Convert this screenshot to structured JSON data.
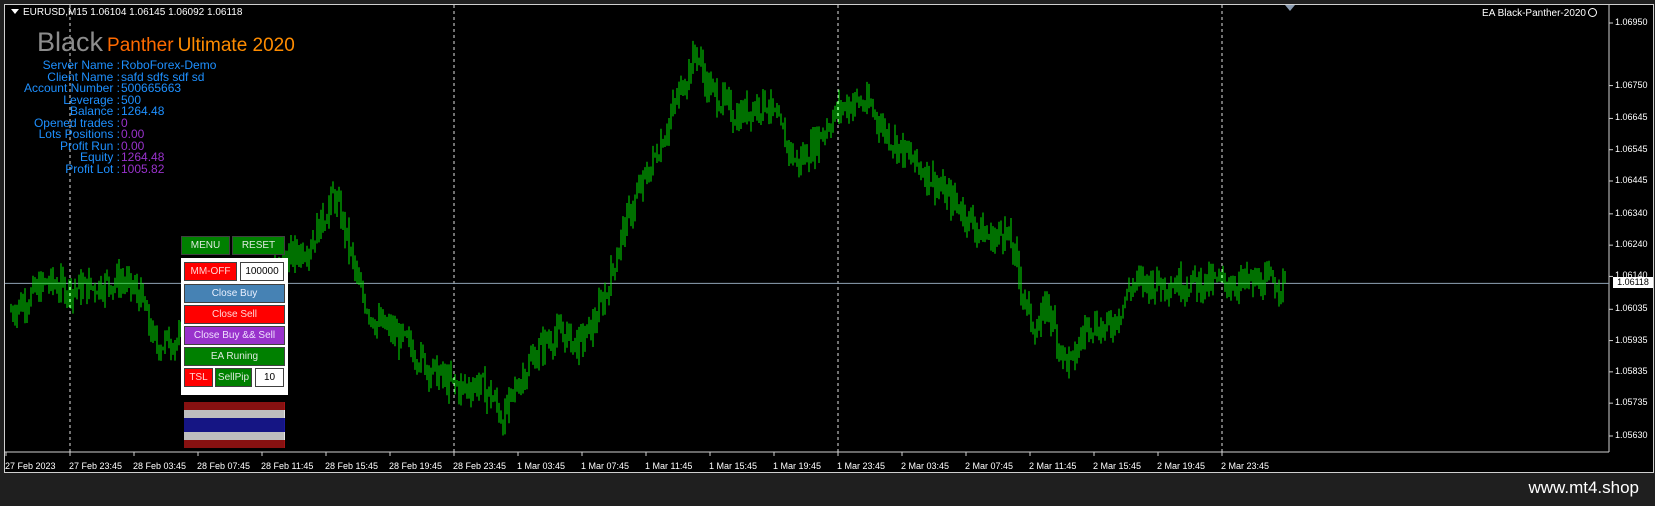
{
  "header": {
    "symbol_line": "EURUSD,M15  1.06104 1.06145 1.06092 1.06118",
    "ea_label": "EA Black-Panther-2020"
  },
  "logo": {
    "word1": "Black",
    "word2": "Panther",
    "word3": "Ultimate 2020"
  },
  "info": [
    {
      "label": "Server Name :",
      "value": "RoboForex-Demo",
      "value_color": "#1e90ff"
    },
    {
      "label": "Client Name :",
      "value": "safd     sdfs sdf  sd",
      "value_color": "#1e90ff"
    },
    {
      "label": "Account Number :",
      "value": "500665663",
      "value_color": "#1e90ff"
    },
    {
      "label": "Leverage :",
      "value": "500",
      "value_color": "#1e90ff"
    },
    {
      "label": "Balance :",
      "value": "1264.48",
      "value_color": "#1e90ff"
    },
    {
      "label": "Opened trades :",
      "value": "0",
      "value_color": "#9932cc"
    },
    {
      "label": "Lots Positions :",
      "value": "0.00",
      "value_color": "#9932cc"
    },
    {
      "label": "Profit Run :",
      "value": "0.00",
      "value_color": "#9932cc"
    },
    {
      "label": "Equity :",
      "value": "1264.48",
      "value_color": "#9932cc"
    },
    {
      "label": "Profit Lot :",
      "value": "1005.82",
      "value_color": "#9932cc"
    }
  ],
  "panel": {
    "menu": "MENU",
    "reset": "RESET",
    "mm_off": "MM-OFF",
    "mm_value": "100000",
    "close_buy": "Close Buy",
    "close_sell": "Close Sell",
    "close_both": "Close Buy && Sell",
    "ea_running": "EA Runing",
    "tsl": "TSL",
    "sellpip": "SellPip",
    "pip_value": "10"
  },
  "footer": {
    "url": "www.mt4.shop"
  },
  "chart_data": {
    "type": "candlestick",
    "series": "EURUSD M15",
    "price_axis": [
      "1.06950",
      "1.06750",
      "1.06645",
      "1.06545",
      "1.06445",
      "1.06340",
      "1.06240",
      "1.06140",
      "1.06035",
      "1.05935",
      "1.05835",
      "1.05735",
      "1.05630"
    ],
    "current_price": "1.06118",
    "ylim": [
      1.0563,
      1.0695
    ],
    "time_labels": [
      "27 Feb 2023",
      "27 Feb 23:45",
      "28 Feb 03:45",
      "28 Feb 07:45",
      "28 Feb 11:45",
      "28 Feb 15:45",
      "28 Feb 19:45",
      "28 Feb 23:45",
      "1 Mar 03:45",
      "1 Mar 07:45",
      "1 Mar 11:45",
      "1 Mar 15:45",
      "1 Mar 19:45",
      "1 Mar 23:45",
      "2 Mar 03:45",
      "2 Mar 07:45",
      "2 Mar 11:45",
      "2 Mar 15:45",
      "2 Mar 19:45",
      "2 Mar 23:45"
    ],
    "day_separators_at": [
      "27 Feb 23:45",
      "28 Feb 23:45",
      "1 Mar 23:45",
      "2 Mar 23:45"
    ],
    "price_path": [
      [
        0,
        1.0603
      ],
      [
        0.02,
        1.0608
      ],
      [
        0.035,
        1.0612
      ],
      [
        0.06,
        1.061
      ],
      [
        0.085,
        1.0611
      ],
      [
        0.11,
        1.0613
      ],
      [
        0.13,
        1.0608
      ],
      [
        0.145,
        1.0592
      ],
      [
        0.165,
        1.0594
      ],
      [
        0.18,
        1.0591
      ],
      [
        0.2,
        1.06
      ],
      [
        0.215,
        1.061
      ],
      [
        0.23,
        1.061
      ],
      [
        0.245,
        1.0614
      ],
      [
        0.26,
        1.0616
      ],
      [
        0.28,
        1.062
      ],
      [
        0.3,
        1.0624
      ],
      [
        0.31,
        1.063
      ],
      [
        0.325,
        1.064
      ],
      [
        0.335,
        1.063
      ],
      [
        0.35,
        1.061
      ],
      [
        0.365,
        1.06
      ],
      [
        0.38,
        1.0597
      ],
      [
        0.4,
        1.0592
      ],
      [
        0.42,
        1.0585
      ],
      [
        0.44,
        1.058
      ],
      [
        0.455,
        1.0578
      ],
      [
        0.47,
        1.058
      ],
      [
        0.485,
        1.0575
      ],
      [
        0.495,
        1.0568
      ],
      [
        0.51,
        1.058
      ],
      [
        0.525,
        1.0588
      ],
      [
        0.54,
        1.0594
      ],
      [
        0.555,
        1.0596
      ],
      [
        0.57,
        1.0592
      ],
      [
        0.585,
        1.0598
      ],
      [
        0.6,
        1.061
      ],
      [
        0.615,
        1.0628
      ],
      [
        0.63,
        1.064
      ],
      [
        0.645,
        1.065
      ],
      [
        0.66,
        1.0662
      ],
      [
        0.675,
        1.0675
      ],
      [
        0.69,
        1.0686
      ],
      [
        0.7,
        1.0675
      ],
      [
        0.715,
        1.067
      ],
      [
        0.73,
        1.0665
      ],
      [
        0.745,
        1.0668
      ],
      [
        0.76,
        1.067
      ],
      [
        0.775,
        1.066
      ],
      [
        0.79,
        1.065
      ],
      [
        0.805,
        1.0655
      ],
      [
        0.82,
        1.0662
      ],
      [
        0.835,
        1.0668
      ],
      [
        0.85,
        1.067
      ],
      [
        0.865,
        1.0668
      ],
      [
        0.88,
        1.066
      ],
      [
        0.895,
        1.0655
      ],
      [
        0.91,
        1.065
      ],
      [
        0.925,
        1.0646
      ],
      [
        0.94,
        1.064
      ],
      [
        0.955,
        1.0636
      ],
      [
        0.97,
        1.063
      ],
      [
        0.985,
        1.0626
      ],
      [
        1.0,
        1.0628
      ]
    ],
    "price_path2": [
      [
        0,
        1.0628
      ],
      [
        0.03,
        1.0622
      ],
      [
        0.06,
        1.061
      ],
      [
        0.09,
        1.06
      ],
      [
        0.12,
        1.0597
      ],
      [
        0.15,
        1.0606
      ],
      [
        0.18,
        1.0596
      ],
      [
        0.21,
        1.0588
      ],
      [
        0.24,
        1.0586
      ],
      [
        0.27,
        1.0594
      ],
      [
        0.3,
        1.06
      ],
      [
        0.33,
        1.0598
      ],
      [
        0.36,
        1.0597
      ],
      [
        0.39,
        1.06
      ],
      [
        0.42,
        1.0605
      ],
      [
        0.45,
        1.0611
      ],
      [
        0.48,
        1.0612
      ]
    ]
  }
}
